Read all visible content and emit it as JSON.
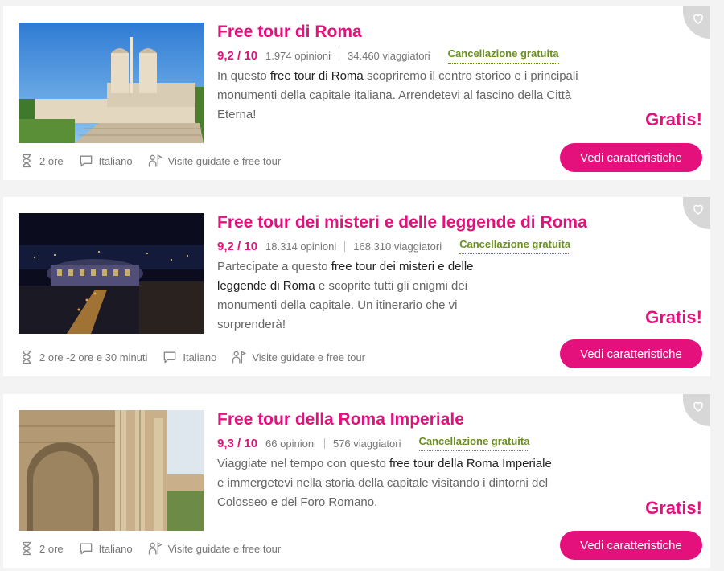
{
  "colors": {
    "accent": "#e4117d",
    "cancel": "#6a8f1f"
  },
  "tours": [
    {
      "title": "Free tour di Roma",
      "rating": "9,2 / 10",
      "reviews": "1.974 opinioni",
      "travelers": "34.460 viaggiatori",
      "cancellation": "Cancellazione gratuita",
      "desc_pre": "In questo ",
      "desc_bold": "free tour di Roma",
      "desc_post": " scopriremo il centro storico e i principali monumenti della capitale italiana. Arrendetevi al fascino della Città Eterna!",
      "price": "Gratis!",
      "button": "Vedi caratteristiche",
      "duration": "2 ore",
      "language": "Italiano",
      "category": "Visite guidate e free tour",
      "image_icon": "spanish-steps-photo"
    },
    {
      "title": "Free tour dei misteri e delle leggende di Roma",
      "rating": "9,2 / 10",
      "reviews": "18.314 opinioni",
      "travelers": "168.310 viaggiatori",
      "cancellation": "Cancellazione gratuita",
      "desc_pre": "Partecipate a questo ",
      "desc_bold": "free tour dei misteri e delle leggende di Roma",
      "desc_post": " e scoprite tutti gli enigmi dei monumenti della capitale. Un itinerario che vi sorprenderà!",
      "price": "Gratis!",
      "button": "Vedi caratteristiche",
      "duration": "2 ore -2 ore e 30 minuti",
      "language": "Italiano",
      "category": "Visite guidate e free tour",
      "image_icon": "colosseum-night-photo"
    },
    {
      "title": "Free tour della Roma Imperiale",
      "rating": "9,3 / 10",
      "reviews": "66 opinioni",
      "travelers": "576 viaggiatori",
      "cancellation": "Cancellazione gratuita",
      "desc_pre": "Viaggiate nel tempo con questo ",
      "desc_bold": "free tour della Roma Imperiale",
      "desc_post": " e immergetevi nella storia della capitale visitando i dintorni del Colosseo e del Foro Romano.",
      "price": "Gratis!",
      "button": "Vedi caratteristiche",
      "duration": "2 ore",
      "language": "Italiano",
      "category": "Visite guidate e free tour",
      "image_icon": "roman-arch-photo"
    }
  ]
}
